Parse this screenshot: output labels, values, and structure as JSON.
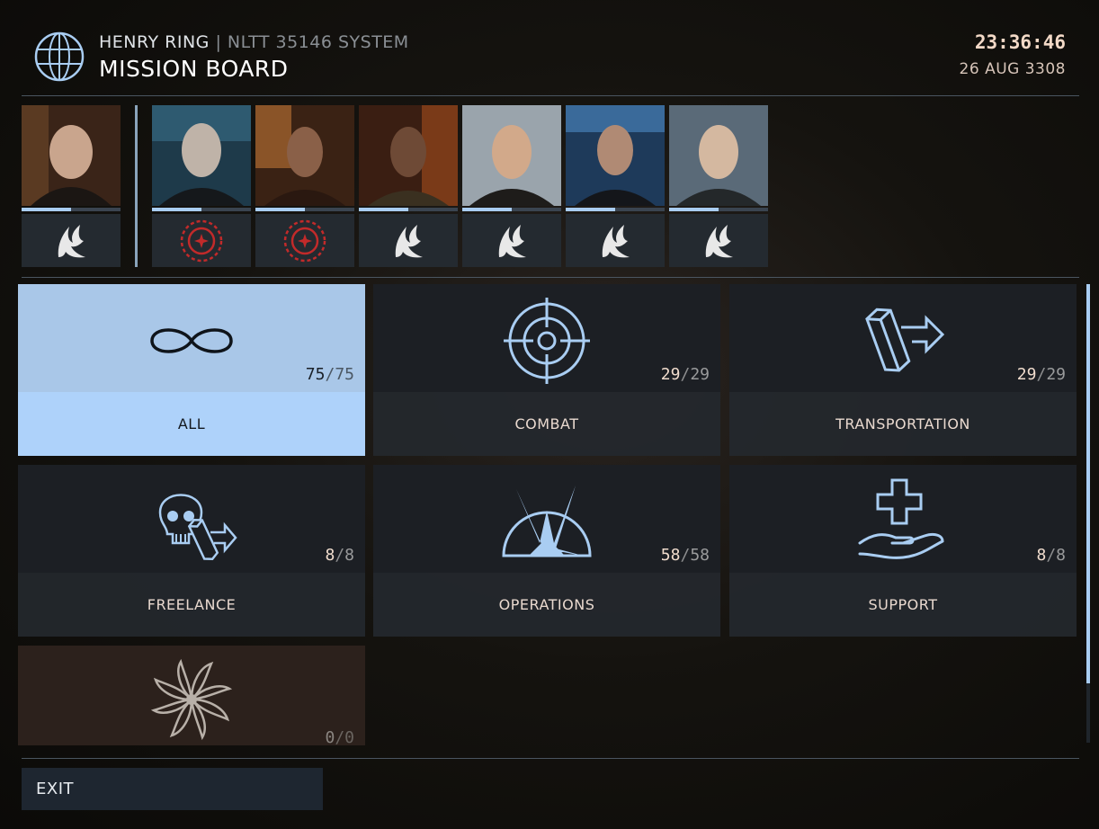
{
  "header": {
    "station": "HENRY RING",
    "separator": "|",
    "system": "NLTT 35146 SYSTEM",
    "title": "MISSION BOARD",
    "time": "23:36:46",
    "date": "26 AUG 3308",
    "icon": "globe-icon"
  },
  "portraits": [
    {
      "faction_icon": "federation-eagle-icon",
      "reputation": 0.5,
      "emblem_color": "#e8e8e8"
    },
    {
      "faction_icon": "independent-ring-icon",
      "reputation": 0.5,
      "emblem_color": "#c22a2a"
    },
    {
      "faction_icon": "independent-ring-icon",
      "reputation": 0.5,
      "emblem_color": "#c22a2a"
    },
    {
      "faction_icon": "federation-eagle-icon",
      "reputation": 0.5,
      "emblem_color": "#e8e8e8"
    },
    {
      "faction_icon": "federation-eagle-icon",
      "reputation": 0.5,
      "emblem_color": "#e8e8e8"
    },
    {
      "faction_icon": "federation-eagle-icon",
      "reputation": 0.5,
      "emblem_color": "#e8e8e8"
    },
    {
      "faction_icon": "federation-eagle-icon",
      "reputation": 0.5,
      "emblem_color": "#e8e8e8"
    }
  ],
  "categories": [
    {
      "label": "ALL",
      "count": "75",
      "total": "75",
      "icon": "infinity-icon",
      "state": "active"
    },
    {
      "label": "COMBAT",
      "count": "29",
      "total": "29",
      "icon": "crosshair-icon",
      "state": "normal"
    },
    {
      "label": "TRANSPORTATION",
      "count": "29",
      "total": "29",
      "icon": "cargo-arrow-icon",
      "state": "normal"
    },
    {
      "label": "FREELANCE",
      "count": "8",
      "total": "8",
      "icon": "skull-cargo-icon",
      "state": "normal"
    },
    {
      "label": "OPERATIONS",
      "count": "58",
      "total": "58",
      "icon": "burst-dome-icon",
      "state": "normal"
    },
    {
      "label": "SUPPORT",
      "count": "8",
      "total": "8",
      "icon": "hand-cross-icon",
      "state": "normal"
    },
    {
      "label": "",
      "count": "0",
      "total": "0",
      "icon": "pinwheel-icon",
      "state": "disabled"
    }
  ],
  "scroll": {
    "position": 0.0,
    "visible_fraction": 0.87
  },
  "exit_label": "EXIT",
  "colors": {
    "accent": "#aed2fa",
    "accent_dark": "#a9c7e8",
    "tile_bg": "#24282e",
    "text_warm": "#e9d9cf",
    "faction_red": "#c22a2a"
  }
}
